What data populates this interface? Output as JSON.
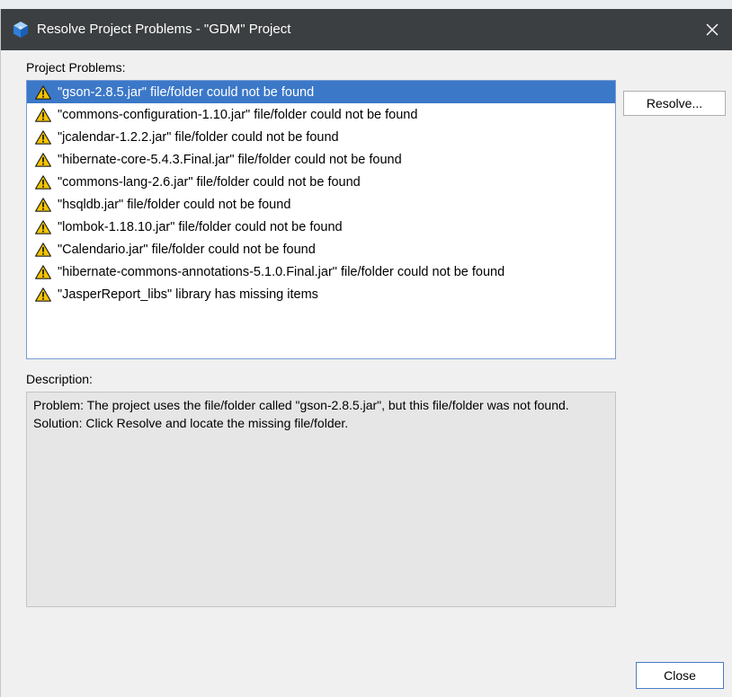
{
  "window": {
    "title": "Resolve Project Problems - \"GDM\" Project"
  },
  "problems": {
    "label": "Project Problems:",
    "items": [
      {
        "text": "\"gson-2.8.5.jar\" file/folder could not be found",
        "selected": true
      },
      {
        "text": "\"commons-configuration-1.10.jar\" file/folder could not be found",
        "selected": false
      },
      {
        "text": "\"jcalendar-1.2.2.jar\" file/folder could not be found",
        "selected": false
      },
      {
        "text": "\"hibernate-core-5.4.3.Final.jar\" file/folder could not be found",
        "selected": false
      },
      {
        "text": "\"commons-lang-2.6.jar\" file/folder could not be found",
        "selected": false
      },
      {
        "text": "\"hsqldb.jar\" file/folder could not be found",
        "selected": false
      },
      {
        "text": "\"lombok-1.18.10.jar\" file/folder could not be found",
        "selected": false
      },
      {
        "text": "\"Calendario.jar\" file/folder could not be found",
        "selected": false
      },
      {
        "text": "\"hibernate-commons-annotations-5.1.0.Final.jar\" file/folder could not be found",
        "selected": false
      },
      {
        "text": "\"JasperReport_libs\" library has missing items",
        "selected": false
      }
    ]
  },
  "buttons": {
    "resolve_label": "Resolve...",
    "close_label": "Close"
  },
  "description": {
    "label": "Description:",
    "problem_text": "Problem: The project uses the file/folder called \"gson-2.8.5.jar\", but this file/folder was not found.",
    "solution_text": "Solution: Click Resolve and locate the missing file/folder."
  },
  "colors": {
    "titlebar": "#3c3f41",
    "selection": "#3c78c8",
    "warning": "#f5c400"
  },
  "icons": {
    "app": "netbeans-cube-icon",
    "close": "close-icon",
    "problem": "warning-triangle-icon"
  }
}
